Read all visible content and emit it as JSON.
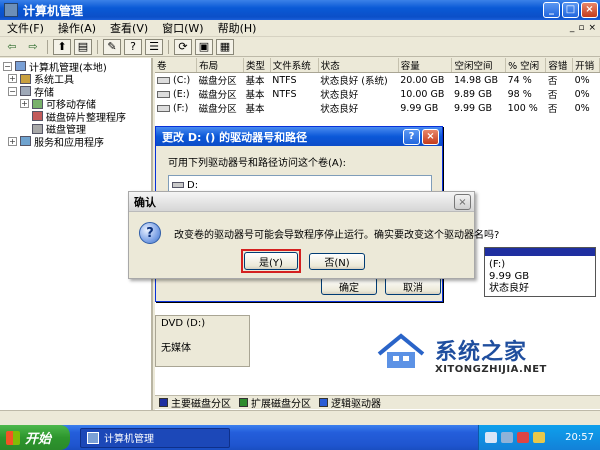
{
  "window": {
    "title": "计算机管理"
  },
  "menu": [
    "文件(F)",
    "操作(A)",
    "查看(V)",
    "窗口(W)",
    "帮助(H)"
  ],
  "tree": [
    {
      "label": "计算机管理(本地)",
      "indent": 0,
      "expander": "−",
      "icon": "computer-icon"
    },
    {
      "label": "系统工具",
      "indent": 1,
      "expander": "+",
      "icon": "tools-icon"
    },
    {
      "label": "存储",
      "indent": 1,
      "expander": "−",
      "icon": "storage-icon"
    },
    {
      "label": "可移动存储",
      "indent": 2,
      "expander": "+",
      "icon": "removable-storage-icon"
    },
    {
      "label": "磁盘碎片整理程序",
      "indent": 2,
      "expander": "",
      "icon": "defrag-icon"
    },
    {
      "label": "磁盘管理",
      "indent": 2,
      "expander": "",
      "icon": "disk-management-icon"
    },
    {
      "label": "服务和应用程序",
      "indent": 1,
      "expander": "+",
      "icon": "services-icon"
    }
  ],
  "volume_table": {
    "headers": [
      "卷",
      "布局",
      "类型",
      "文件系统",
      "状态",
      "容量",
      "空闲空间",
      "% 空闲",
      "容错",
      "开销"
    ],
    "rows": [
      [
        "(C:)",
        "磁盘分区",
        "基本",
        "NTFS",
        "状态良好 (系统)",
        "20.00 GB",
        "14.98 GB",
        "74 %",
        "否",
        "0%"
      ],
      [
        "(E:)",
        "磁盘分区",
        "基本",
        "NTFS",
        "状态良好",
        "10.00 GB",
        "9.89 GB",
        "98 %",
        "否",
        "0%"
      ],
      [
        "(F:)",
        "磁盘分区",
        "基本",
        "",
        "状态良好",
        "9.99 GB",
        "9.99 GB",
        "100 %",
        "否",
        "0%"
      ]
    ]
  },
  "graph": {
    "dvd_label": "DVD (D:)",
    "dvd_status": "无媒体",
    "f_volume": {
      "name": "(F:)",
      "size": "9.99 GB",
      "status": "状态良好"
    }
  },
  "legend": [
    {
      "label": "主要磁盘分区",
      "color": "#1f2fa0"
    },
    {
      "label": "扩展磁盘分区",
      "color": "#2e8b2e"
    },
    {
      "label": "逻辑驱动器",
      "color": "#2a5cd6"
    }
  ],
  "change_dialog": {
    "title": "更改 D: () 的驱动器号和路径",
    "instruction": "可用下列驱动器号和路径访问这个卷(A):",
    "list_item": "D:",
    "ok": "确定",
    "cancel": "取消"
  },
  "confirm_dialog": {
    "title": "确认",
    "message": "改变卷的驱动器号可能会导致程序停止运行。确实要改变这个驱动器名吗?",
    "yes": "是(Y)",
    "no": "否(N)"
  },
  "watermark": {
    "title": "系统之家",
    "subtitle": "XITONGZHIJIA.NET"
  },
  "taskbar": {
    "start": "开始",
    "task": "计算机管理",
    "clock": "20:57"
  }
}
